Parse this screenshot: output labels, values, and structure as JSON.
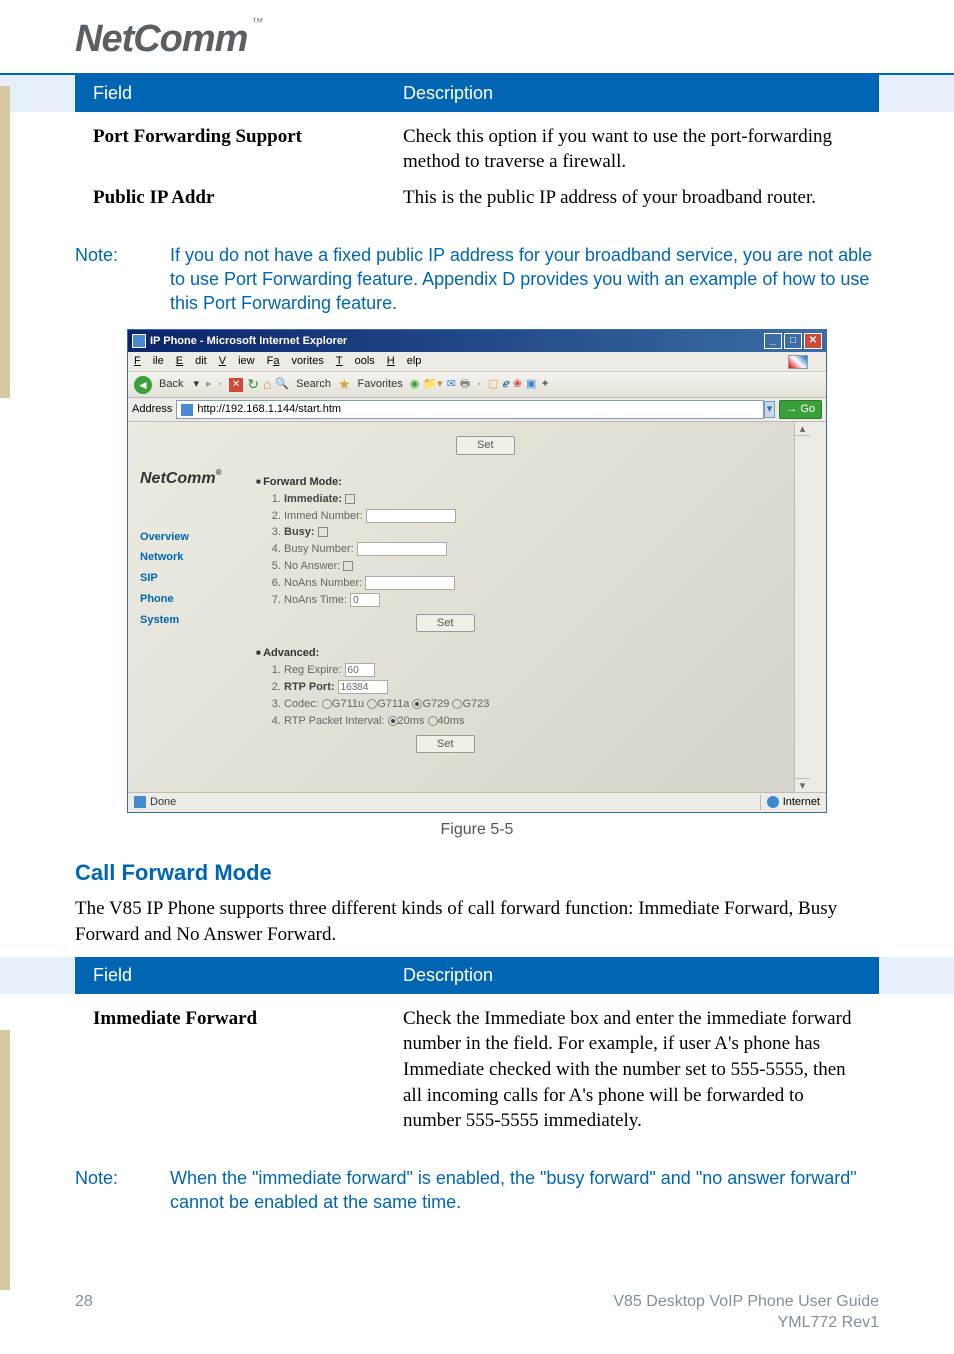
{
  "logo": {
    "brand": "NetComm",
    "tm": "™"
  },
  "table1": {
    "head_field": "Field",
    "head_desc": "Description",
    "rows": [
      {
        "field": "Port Forwarding Support",
        "desc": "Check this option if you want to use the port-forwarding method to traverse a firewall."
      },
      {
        "field": "Public IP Addr",
        "desc": "This is the public IP address of your broadband router."
      }
    ]
  },
  "note1": {
    "label": "Note:",
    "text": "If you do not have a fixed public IP address for your broadband service, you are not able to use Port Forwarding feature.  Appendix D provides you with an example of how to use this Port Forwarding feature."
  },
  "ie": {
    "title": "IP Phone - Microsoft Internet Explorer",
    "menu": {
      "file": "File",
      "edit": "Edit",
      "view": "View",
      "favorites": "Favorites",
      "tools": "Tools",
      "help": "Help"
    },
    "toolbar": {
      "back": "Back",
      "search": "Search",
      "favorites": "Favorites"
    },
    "addr": {
      "label": "Address",
      "url": "http://192.168.1.144/start.htm",
      "go": "Go"
    },
    "sidebar": {
      "brand": "NetComm",
      "reg": "®",
      "nav": [
        "Overview",
        "Network",
        "SIP",
        "Phone",
        "System"
      ]
    },
    "set_btn": "Set",
    "forward": {
      "heading": "Forward Mode:",
      "items": {
        "immediate_label": "Immediate:",
        "immed_num_label": "Immed Number:",
        "busy_label": "Busy:",
        "busy_num_label": "Busy Number:",
        "noanswer_label": "No Answer:",
        "noans_num_label": "NoAns Number:",
        "noans_time_label": "NoAns Time:",
        "noans_time_val": "0"
      }
    },
    "advanced": {
      "heading": "Advanced:",
      "reg_expire_label": "Reg Expire:",
      "reg_expire_val": "60",
      "rtp_port_label": "RTP Port:",
      "rtp_port_val": "16384",
      "codec_label": "Codec:",
      "codec_opts": [
        "G711u",
        "G711a",
        "G729",
        "G723"
      ],
      "rtp_interval_label": "RTP Packet Interval:",
      "rtp_interval_opts": [
        "20ms",
        "40ms"
      ]
    },
    "status": {
      "done": "Done",
      "zone": "Internet"
    }
  },
  "figure_caption": "Figure 5-5",
  "section2": {
    "heading": "Call Forward Mode",
    "para": "The V85 IP Phone supports three different kinds of call forward function: Immediate Forward, Busy Forward and No Answer Forward."
  },
  "table2": {
    "head_field": "Field",
    "head_desc": "Description",
    "rows": [
      {
        "field": "Immediate Forward",
        "desc": "Check the Immediate box and enter the immediate forward number in the field. For example, if user A's phone has Immediate checked with the number set to 555-5555, then all incoming calls for A's phone will be forwarded to number 555-5555 immediately."
      }
    ]
  },
  "note2": {
    "label": "Note:",
    "text": "When the \"immediate forward\" is enabled, the \"busy forward\" and \"no answer forward\" cannot be enabled at the same time."
  },
  "footer": {
    "page": "28",
    "title": "V85 Desktop VoIP Phone User Guide",
    "rev": "YML772 Rev1"
  }
}
